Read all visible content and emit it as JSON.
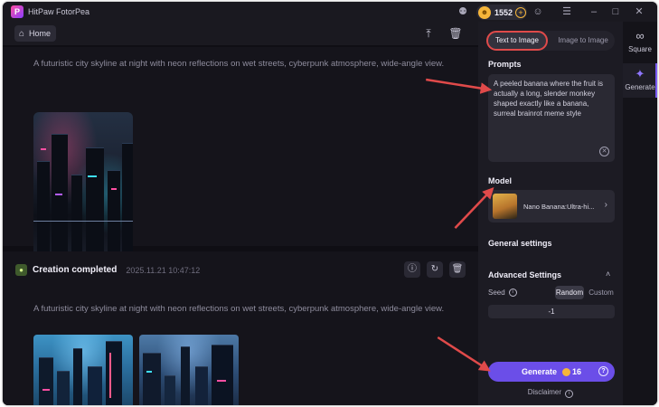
{
  "app": {
    "title": "HitPaw FotorPea",
    "logo_letter": "P"
  },
  "titlebar": {
    "coins": "1552",
    "icons": [
      "discord-icon",
      "coin-icon",
      "plus-icon",
      "user-icon",
      "menu-icon",
      "minimize-icon",
      "maximize-icon",
      "close-icon"
    ]
  },
  "topbar": {
    "home_label": "Home"
  },
  "feed": {
    "prompt": "A futuristic city skyline at night with neon reflections on wet streets, cyberpunk atmosphere, wide-angle view.",
    "item2": {
      "status": "Creation completed",
      "time": "2025.11.21  10:47:12",
      "prompt": "A futuristic city skyline at night with neon reflections on wet streets, cyberpunk atmosphere, wide-angle view."
    }
  },
  "panel": {
    "mode_tabs": [
      "Text to Image",
      "Image to Image"
    ],
    "prompts_title": "Prompts",
    "prompt_value": "A peeled banana where the fruit is actually a long, slender monkey shaped exactly like a banana, surreal brainrot meme style",
    "model_title": "Model",
    "model_name": "Nano Banana:Ultra-hi...",
    "general_title": "General settings",
    "advanced_title": "Advanced Settings",
    "seed_label": "Seed",
    "seed_options": [
      "Random",
      "Custom"
    ],
    "seed_value": "-1",
    "generate_label": "Generate",
    "generate_cost": "16",
    "disclaimer": "Disclaimer"
  },
  "rail": {
    "items": [
      "Square",
      "Generate"
    ]
  },
  "colors": {
    "accent": "#6b4ee8",
    "annotation": "#e04a4a",
    "coin": "#f5b53a"
  }
}
